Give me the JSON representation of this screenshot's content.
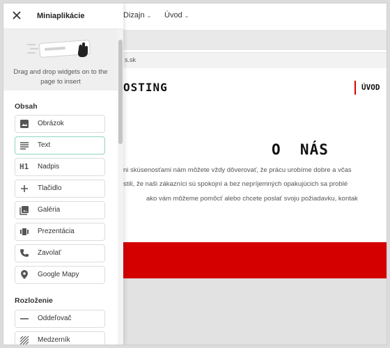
{
  "top_menu": [
    {
      "label": "Dizajn"
    },
    {
      "label": "Úvod"
    }
  ],
  "url_fragment": "s.sk",
  "site": {
    "logo": "OSTING",
    "nav_item": "ÚVOD",
    "heading": "O  NÁS",
    "paragraph_lines": [
      "ni skúsenosťami nám môžete vždy dôverovať, že prácu urobíme dobre a včas",
      "stili, že naši zákazníci sú spokojní a bez nepríjemných opakujúcich sa problé",
      "ako vám môžeme pomôcť alebo chcete poslať svoju požiadavku, kontak"
    ],
    "band_color": "#d40000"
  },
  "panel": {
    "title": "Miniaplikácie",
    "dnd_hint": "Drag and drop widgets on to the page to insert",
    "sections": [
      {
        "title": "Obsah",
        "items": [
          {
            "label": "Obrázok",
            "icon": "image-icon"
          },
          {
            "label": "Text",
            "icon": "text-icon"
          },
          {
            "label": "Nadpis",
            "icon": "heading-icon"
          },
          {
            "label": "Tlačidlo",
            "icon": "plus-icon"
          },
          {
            "label": "Galéria",
            "icon": "gallery-icon"
          },
          {
            "label": "Prezentácia",
            "icon": "slideshow-icon"
          },
          {
            "label": "Zavolať",
            "icon": "phone-icon"
          },
          {
            "label": "Google Mapy",
            "icon": "map-pin-icon"
          }
        ]
      },
      {
        "title": "Rozloženie",
        "items": [
          {
            "label": "Oddeľovač",
            "icon": "divider-icon"
          },
          {
            "label": "Medzerník",
            "icon": "spacer-icon"
          }
        ]
      }
    ],
    "active_item": "Text",
    "accent_color": "#8fd3c3"
  }
}
